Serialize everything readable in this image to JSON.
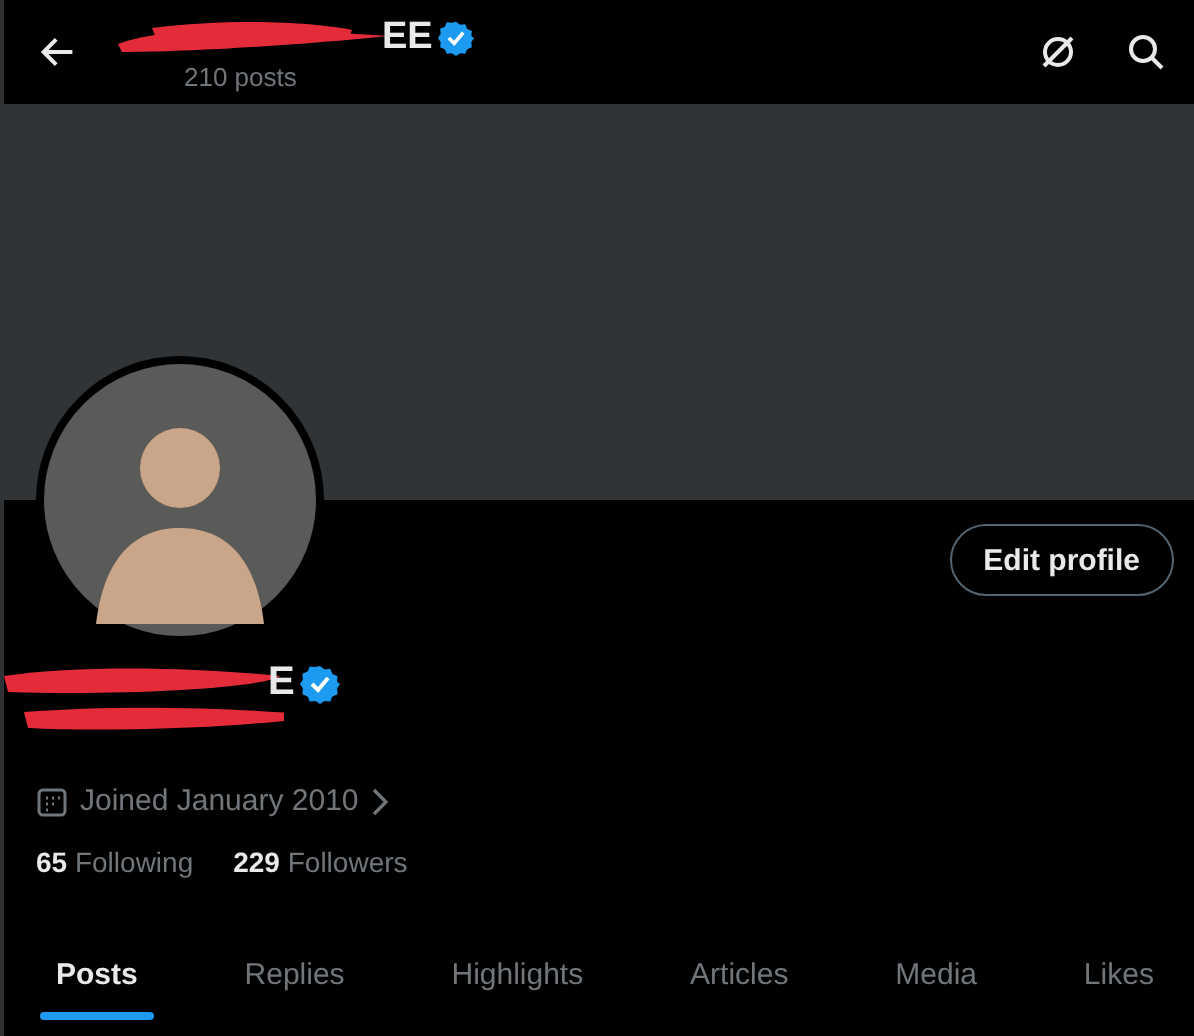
{
  "header": {
    "name_visible": "EE",
    "verified": true,
    "posts_count": "210 posts"
  },
  "profile": {
    "name_visible": "E",
    "verified": true,
    "joined": "Joined January 2010",
    "following_count": "65",
    "following_label": "Following",
    "followers_count": "229",
    "followers_label": "Followers"
  },
  "edit_button": "Edit profile",
  "tabs": [
    {
      "label": "Posts",
      "selected": true
    },
    {
      "label": "Replies",
      "selected": false
    },
    {
      "label": "Highlights",
      "selected": false
    },
    {
      "label": "Articles",
      "selected": false
    },
    {
      "label": "Media",
      "selected": false
    },
    {
      "label": "Likes",
      "selected": false
    }
  ]
}
